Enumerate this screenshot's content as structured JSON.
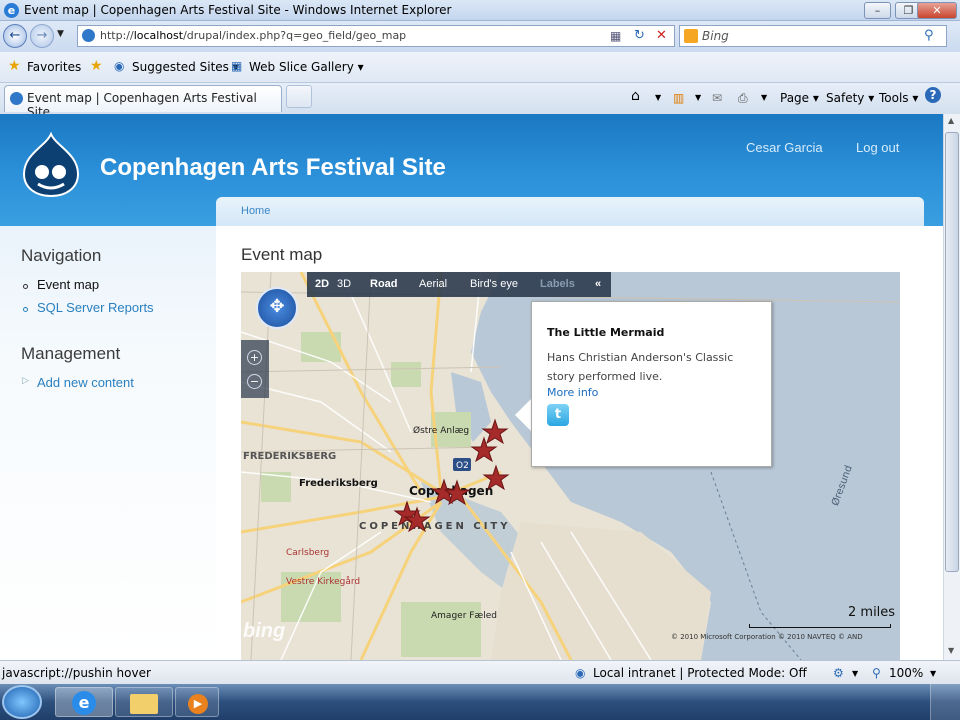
{
  "browser": {
    "window_title": "Event map | Copenhagen Arts Festival Site - Windows Internet Explorer",
    "url_prefix": "http://",
    "url_host": "localhost",
    "url_path": "/drupal/index.php?q=geo_field/geo_map",
    "search_placeholder": "Bing",
    "favorites_label": "Favorites",
    "suggested_sites_label": "Suggested Sites",
    "web_slice_label": "Web Slice Gallery",
    "tab_title": "Event map | Copenhagen Arts Festival Site",
    "page_menu": "Page",
    "safety_menu": "Safety",
    "tools_menu": "Tools"
  },
  "site": {
    "name": "Copenhagen Arts Festival Site",
    "user_link": "Cesar Garcia",
    "logout_link": "Log out",
    "breadcrumb": "Home"
  },
  "sidebar": {
    "navigation_title": "Navigation",
    "nav_items": [
      "Event map",
      "SQL Server Reports"
    ],
    "management_title": "Management",
    "management_items": [
      "Add new content"
    ]
  },
  "main": {
    "page_title": "Event map",
    "map": {
      "modes": [
        "2D",
        "3D"
      ],
      "views": [
        "Road",
        "Aerial",
        "Bird's eye",
        "Labels"
      ],
      "collapse": "«",
      "scale_label": "2 miles",
      "logo": "bing",
      "copyright": "© 2010 Microsoft Corporation  © 2010 NAVTEQ  © AND",
      "city_labels": [
        "Copenhagen",
        "COPENHAGEN CITY",
        "Frederiksberg",
        "FREDERIKSBERG",
        "Østre Anlæg",
        "Carlsberg",
        "Vestre Kirkegård",
        "Amager Fæled",
        "Øresund"
      ],
      "popup": {
        "title": "The Little Mermaid",
        "description": "Hans Christian Anderson's Classic story performed live.",
        "more_link": "More info",
        "share_icon": "twitter-icon"
      }
    }
  },
  "status": {
    "url_text": "javascript://pushin hover",
    "zone": "Local intranet | Protected Mode: Off",
    "zoom": "100%"
  }
}
